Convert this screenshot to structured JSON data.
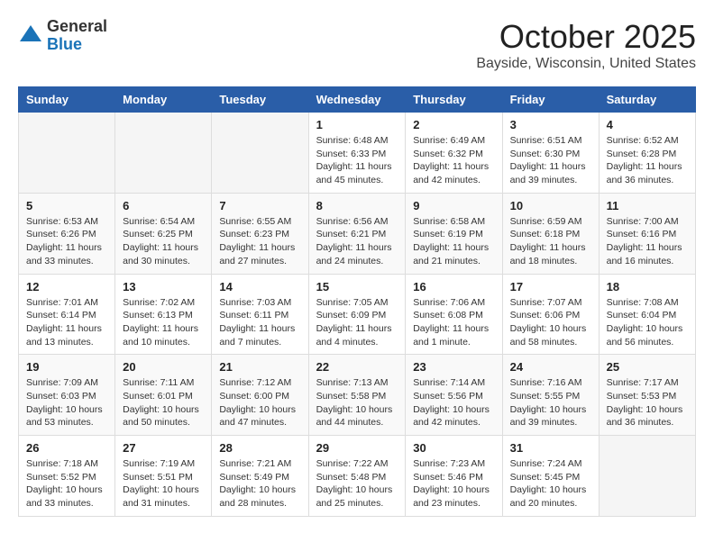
{
  "header": {
    "logo_general": "General",
    "logo_blue": "Blue",
    "month_title": "October 2025",
    "location": "Bayside, Wisconsin, United States"
  },
  "calendar": {
    "days_of_week": [
      "Sunday",
      "Monday",
      "Tuesday",
      "Wednesday",
      "Thursday",
      "Friday",
      "Saturday"
    ],
    "weeks": [
      [
        {
          "day": "",
          "info": ""
        },
        {
          "day": "",
          "info": ""
        },
        {
          "day": "",
          "info": ""
        },
        {
          "day": "1",
          "info": "Sunrise: 6:48 AM\nSunset: 6:33 PM\nDaylight: 11 hours and 45 minutes."
        },
        {
          "day": "2",
          "info": "Sunrise: 6:49 AM\nSunset: 6:32 PM\nDaylight: 11 hours and 42 minutes."
        },
        {
          "day": "3",
          "info": "Sunrise: 6:51 AM\nSunset: 6:30 PM\nDaylight: 11 hours and 39 minutes."
        },
        {
          "day": "4",
          "info": "Sunrise: 6:52 AM\nSunset: 6:28 PM\nDaylight: 11 hours and 36 minutes."
        }
      ],
      [
        {
          "day": "5",
          "info": "Sunrise: 6:53 AM\nSunset: 6:26 PM\nDaylight: 11 hours and 33 minutes."
        },
        {
          "day": "6",
          "info": "Sunrise: 6:54 AM\nSunset: 6:25 PM\nDaylight: 11 hours and 30 minutes."
        },
        {
          "day": "7",
          "info": "Sunrise: 6:55 AM\nSunset: 6:23 PM\nDaylight: 11 hours and 27 minutes."
        },
        {
          "day": "8",
          "info": "Sunrise: 6:56 AM\nSunset: 6:21 PM\nDaylight: 11 hours and 24 minutes."
        },
        {
          "day": "9",
          "info": "Sunrise: 6:58 AM\nSunset: 6:19 PM\nDaylight: 11 hours and 21 minutes."
        },
        {
          "day": "10",
          "info": "Sunrise: 6:59 AM\nSunset: 6:18 PM\nDaylight: 11 hours and 18 minutes."
        },
        {
          "day": "11",
          "info": "Sunrise: 7:00 AM\nSunset: 6:16 PM\nDaylight: 11 hours and 16 minutes."
        }
      ],
      [
        {
          "day": "12",
          "info": "Sunrise: 7:01 AM\nSunset: 6:14 PM\nDaylight: 11 hours and 13 minutes."
        },
        {
          "day": "13",
          "info": "Sunrise: 7:02 AM\nSunset: 6:13 PM\nDaylight: 11 hours and 10 minutes."
        },
        {
          "day": "14",
          "info": "Sunrise: 7:03 AM\nSunset: 6:11 PM\nDaylight: 11 hours and 7 minutes."
        },
        {
          "day": "15",
          "info": "Sunrise: 7:05 AM\nSunset: 6:09 PM\nDaylight: 11 hours and 4 minutes."
        },
        {
          "day": "16",
          "info": "Sunrise: 7:06 AM\nSunset: 6:08 PM\nDaylight: 11 hours and 1 minute."
        },
        {
          "day": "17",
          "info": "Sunrise: 7:07 AM\nSunset: 6:06 PM\nDaylight: 10 hours and 58 minutes."
        },
        {
          "day": "18",
          "info": "Sunrise: 7:08 AM\nSunset: 6:04 PM\nDaylight: 10 hours and 56 minutes."
        }
      ],
      [
        {
          "day": "19",
          "info": "Sunrise: 7:09 AM\nSunset: 6:03 PM\nDaylight: 10 hours and 53 minutes."
        },
        {
          "day": "20",
          "info": "Sunrise: 7:11 AM\nSunset: 6:01 PM\nDaylight: 10 hours and 50 minutes."
        },
        {
          "day": "21",
          "info": "Sunrise: 7:12 AM\nSunset: 6:00 PM\nDaylight: 10 hours and 47 minutes."
        },
        {
          "day": "22",
          "info": "Sunrise: 7:13 AM\nSunset: 5:58 PM\nDaylight: 10 hours and 44 minutes."
        },
        {
          "day": "23",
          "info": "Sunrise: 7:14 AM\nSunset: 5:56 PM\nDaylight: 10 hours and 42 minutes."
        },
        {
          "day": "24",
          "info": "Sunrise: 7:16 AM\nSunset: 5:55 PM\nDaylight: 10 hours and 39 minutes."
        },
        {
          "day": "25",
          "info": "Sunrise: 7:17 AM\nSunset: 5:53 PM\nDaylight: 10 hours and 36 minutes."
        }
      ],
      [
        {
          "day": "26",
          "info": "Sunrise: 7:18 AM\nSunset: 5:52 PM\nDaylight: 10 hours and 33 minutes."
        },
        {
          "day": "27",
          "info": "Sunrise: 7:19 AM\nSunset: 5:51 PM\nDaylight: 10 hours and 31 minutes."
        },
        {
          "day": "28",
          "info": "Sunrise: 7:21 AM\nSunset: 5:49 PM\nDaylight: 10 hours and 28 minutes."
        },
        {
          "day": "29",
          "info": "Sunrise: 7:22 AM\nSunset: 5:48 PM\nDaylight: 10 hours and 25 minutes."
        },
        {
          "day": "30",
          "info": "Sunrise: 7:23 AM\nSunset: 5:46 PM\nDaylight: 10 hours and 23 minutes."
        },
        {
          "day": "31",
          "info": "Sunrise: 7:24 AM\nSunset: 5:45 PM\nDaylight: 10 hours and 20 minutes."
        },
        {
          "day": "",
          "info": ""
        }
      ]
    ]
  }
}
